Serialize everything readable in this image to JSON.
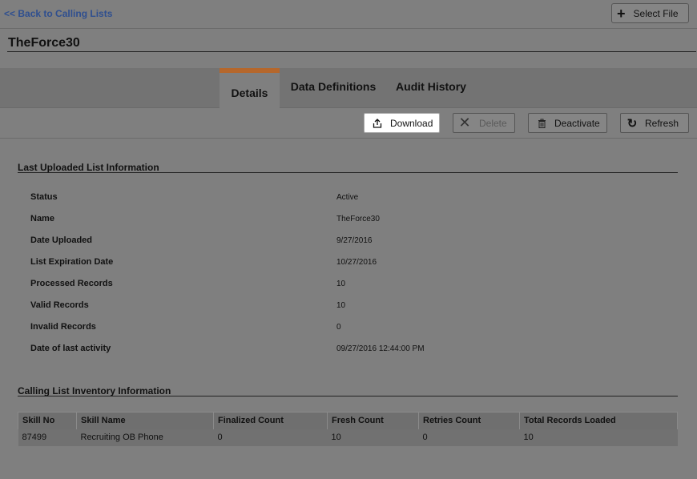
{
  "header": {
    "back_label": "<< Back to Calling Lists",
    "select_file_label": "Select File",
    "page_title": "TheForce30"
  },
  "tabs": [
    {
      "label": "Details",
      "active": true
    },
    {
      "label": "Data Definitions",
      "active": false
    },
    {
      "label": "Audit History",
      "active": false
    }
  ],
  "toolbar": {
    "download_label": "Download",
    "delete_label": "Delete",
    "deactivate_label": "Deactivate",
    "refresh_label": "Refresh"
  },
  "last_uploaded": {
    "section_title": "Last Uploaded List Information",
    "rows": [
      {
        "label": "Status",
        "value": "Active"
      },
      {
        "label": "Name",
        "value": "TheForce30"
      },
      {
        "label": "Date Uploaded",
        "value": "9/27/2016"
      },
      {
        "label": "List Expiration Date",
        "value": "10/27/2016"
      },
      {
        "label": "Processed Records",
        "value": "10"
      },
      {
        "label": "Valid Records",
        "value": "10"
      },
      {
        "label": "Invalid Records",
        "value": "0"
      },
      {
        "label": "Date of last activity",
        "value": "09/27/2016 12:44:00 PM"
      }
    ]
  },
  "inventory": {
    "section_title": "Calling List Inventory Information",
    "columns": [
      "Skill No",
      "Skill Name",
      "Finalized Count",
      "Fresh Count",
      "Retries Count",
      "Total Records Loaded"
    ],
    "rows": [
      [
        "87499",
        "Recruiting OB Phone",
        "0",
        "10",
        "0",
        "10"
      ]
    ]
  },
  "colors": {
    "background": "#7f7f7f",
    "active_tab_accent": "#b5672c",
    "link": "#2f4f8f"
  },
  "icons": {
    "select_file": "plus-icon",
    "download": "upload-share-icon",
    "delete": "x-icon",
    "deactivate": "trash-icon",
    "refresh": "refresh-icon"
  }
}
